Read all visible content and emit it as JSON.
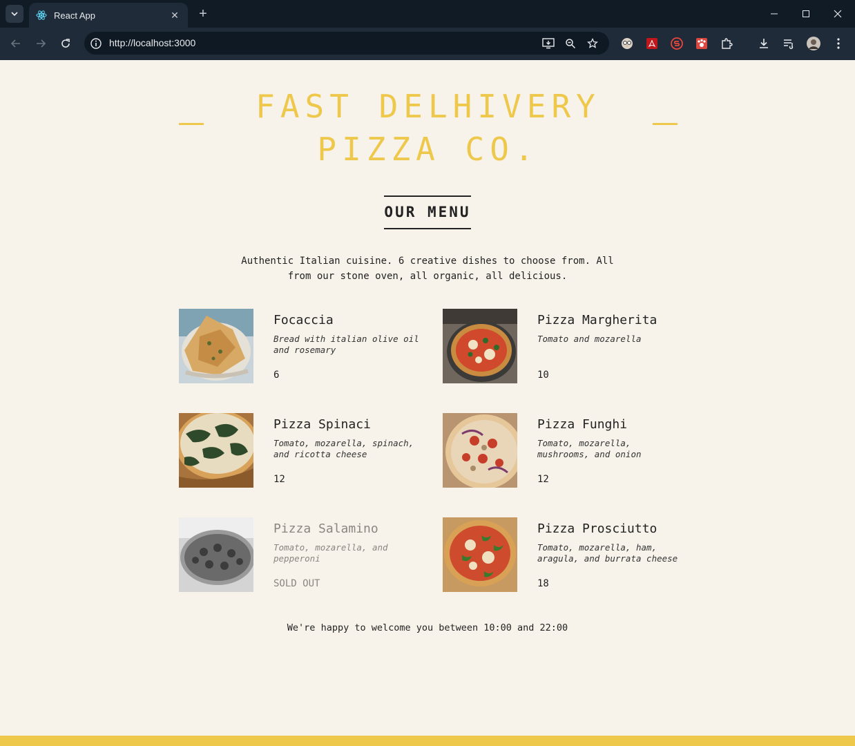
{
  "browser": {
    "tab_title": "React App",
    "url": "http://localhost:3000",
    "new_tab": "+",
    "close_tab": "✕"
  },
  "page": {
    "title": "FAST DELHIVERY PIZZA CO.",
    "menu_heading": "OUR MENU",
    "intro": "Authentic Italian cuisine. 6 creative dishes to choose from. All from our stone oven, all organic, all delicious.",
    "dishes": [
      {
        "name": "Focaccia",
        "description": "Bread with italian olive oil and rosemary",
        "price": "6",
        "sold_out": false
      },
      {
        "name": "Pizza Margherita",
        "description": "Tomato and mozarella",
        "price": "10",
        "sold_out": false
      },
      {
        "name": "Pizza Spinaci",
        "description": "Tomato, mozarella, spinach, and ricotta cheese",
        "price": "12",
        "sold_out": false
      },
      {
        "name": "Pizza Funghi",
        "description": "Tomato, mozarella, mushrooms, and onion",
        "price": "12",
        "sold_out": false
      },
      {
        "name": "Pizza Salamino",
        "description": "Tomato, mozarella, and pepperoni",
        "price": "SOLD OUT",
        "sold_out": true
      },
      {
        "name": "Pizza Prosciutto",
        "description": "Tomato, mozarella, ham, aragula, and burrata cheese",
        "price": "18",
        "sold_out": false
      }
    ],
    "footer": "We're happy to welcome you between 10:00 and 22:00"
  },
  "colors": {
    "accent": "#edc84b",
    "background": "#f7f2ea",
    "text": "#222222",
    "sold_out_text": "#8a8780"
  }
}
